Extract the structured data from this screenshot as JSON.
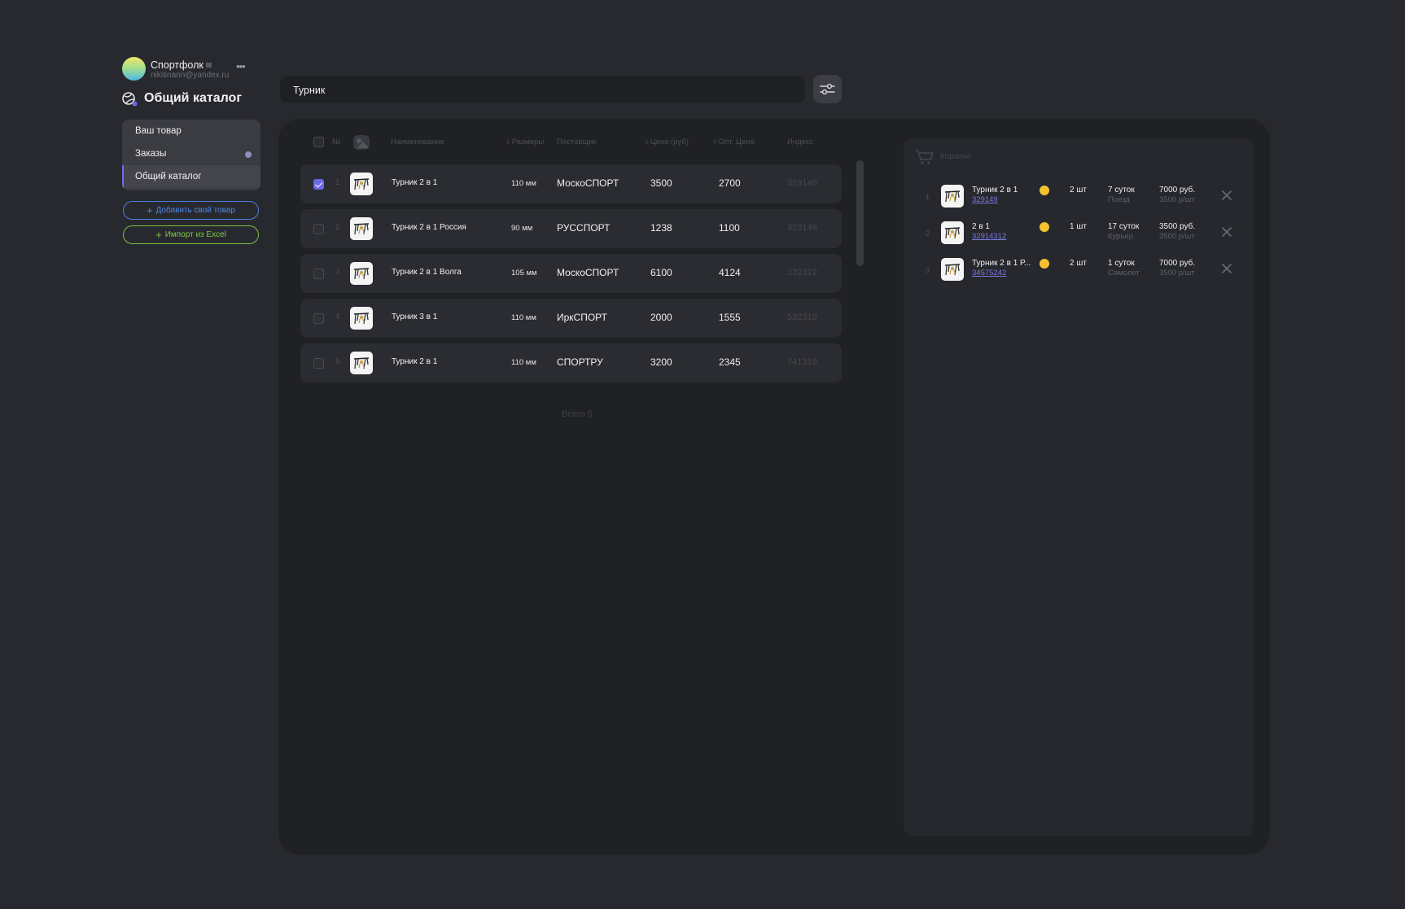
{
  "profile": {
    "name": "Спортфолк",
    "email": "nikitinann@yandex.ru",
    "more": "•••"
  },
  "page_title": "Общий каталог",
  "menu": [
    {
      "label": "Ваш товар"
    },
    {
      "label": "Заказы"
    },
    {
      "label": "Общий каталог"
    }
  ],
  "actions": {
    "add_label": "Добавить свой товар",
    "import_label": "Импорт из Excel"
  },
  "search": {
    "value": "Турник"
  },
  "table": {
    "headers": {
      "num": "№",
      "name": "Наименование",
      "size": "Размеры",
      "supplier": "Поставщик",
      "price": "Цена (руб)",
      "opt": "Опт. Цена",
      "index": "Индекс"
    },
    "rows": [
      {
        "num": "1",
        "name": "Турник 2 в 1",
        "size": "110 мм",
        "supplier": "МоскоСПОРТ",
        "price": "3500",
        "opt": "2700",
        "index": "329149",
        "checked": true
      },
      {
        "num": "2",
        "name": "Турник 2 в 1 Россия",
        "size": "90 мм",
        "supplier": "РУССПОРТ",
        "price": "1238",
        "opt": "1100",
        "index": "323149",
        "checked": false
      },
      {
        "num": "3",
        "name": "Турник 2 в 1 Волга",
        "size": "105 мм",
        "supplier": "МоскоСПОРТ",
        "price": "6100",
        "opt": "4124",
        "index": "332319",
        "checked": false
      },
      {
        "num": "4",
        "name": "Турник 3 в 1",
        "size": "110 мм",
        "supplier": "ИркСПОРТ",
        "price": "2000",
        "opt": "1555",
        "index": "532319",
        "checked": false
      },
      {
        "num": "5",
        "name": "Турник 2 в 1",
        "size": "110 мм",
        "supplier": "СПОРТРУ",
        "price": "3200",
        "opt": "2345",
        "index": "741319",
        "checked": false
      }
    ],
    "total": "Всего 5"
  },
  "cart": {
    "title": "Корзина",
    "items": [
      {
        "num": "1",
        "name": "Турник 2 в 1",
        "link": "329149",
        "qty": "2 шт",
        "days": "7 суток",
        "method": "Поезд",
        "sum": "7000 руб.",
        "per": "3500 р/шт"
      },
      {
        "num": "2",
        "name": "2 в 1",
        "link": "32914312",
        "qty": "1 шт",
        "days": "17 суток",
        "method": "Курьер",
        "sum": "3500 руб.",
        "per": "3500 р/шт"
      },
      {
        "num": "3",
        "name": "Турник 2 в 1 Р...",
        "link": "34575242",
        "qty": "2 шт",
        "days": "1 суток",
        "method": "Самолет",
        "sum": "7000 руб.",
        "per": "3500 р/шт"
      }
    ]
  },
  "colors": {
    "accent": "#6a6ae8",
    "add_button": "#4f86e8",
    "import_button": "#7bc84a",
    "status_dot": "#f3c22e"
  },
  "icons": [
    "catalog-logo-icon",
    "filter-icon",
    "photo-icon",
    "product-image-icon",
    "cart-icon",
    "close-icon",
    "plus-icon",
    "more-icon"
  ]
}
